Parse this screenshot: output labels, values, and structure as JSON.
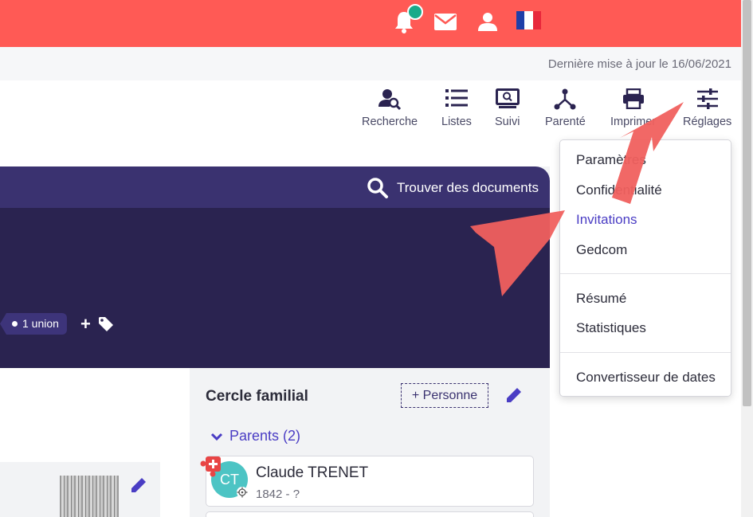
{
  "header": {
    "brand_color": "#ff5a55",
    "notification_dot_color": "#1aaa8a",
    "icons": [
      "bell-icon",
      "mail-icon",
      "user-icon",
      "french-flag-icon"
    ]
  },
  "update_bar": {
    "text": "Dernière mise à jour le 16/06/2021"
  },
  "toolbar": {
    "items": [
      {
        "label": "Recherche",
        "icon": "person-search-icon"
      },
      {
        "label": "Listes",
        "icon": "list-icon"
      },
      {
        "label": "Suivi",
        "icon": "monitor-search-icon"
      },
      {
        "label": "Parenté",
        "icon": "tree-branch-icon"
      },
      {
        "label": "Imprimer",
        "icon": "printer-icon"
      },
      {
        "label": "Réglages",
        "icon": "sliders-icon"
      }
    ]
  },
  "banner": {
    "find_documents": "Trouver des documents",
    "union_tag": "1 union",
    "add_tag": "+"
  },
  "family": {
    "title": "Cercle familial",
    "add_person": "+ Personne",
    "parents_label": "Parents (2)",
    "parents": [
      {
        "initials": "CT",
        "name": "Claude TRENET",
        "dates": "1842 - ?",
        "avatar_color": "#4cc4c4"
      }
    ]
  },
  "dropdown": {
    "group1": [
      "Paramètres",
      "Confidentialité",
      "Invitations",
      "Gedcom"
    ],
    "group2": [
      "Résumé",
      "Statistiques"
    ],
    "group3": [
      "Convertisseur de dates"
    ],
    "active_item": "Invitations",
    "active_color": "#4a3dc4"
  },
  "annotation_color": "#f0605e"
}
